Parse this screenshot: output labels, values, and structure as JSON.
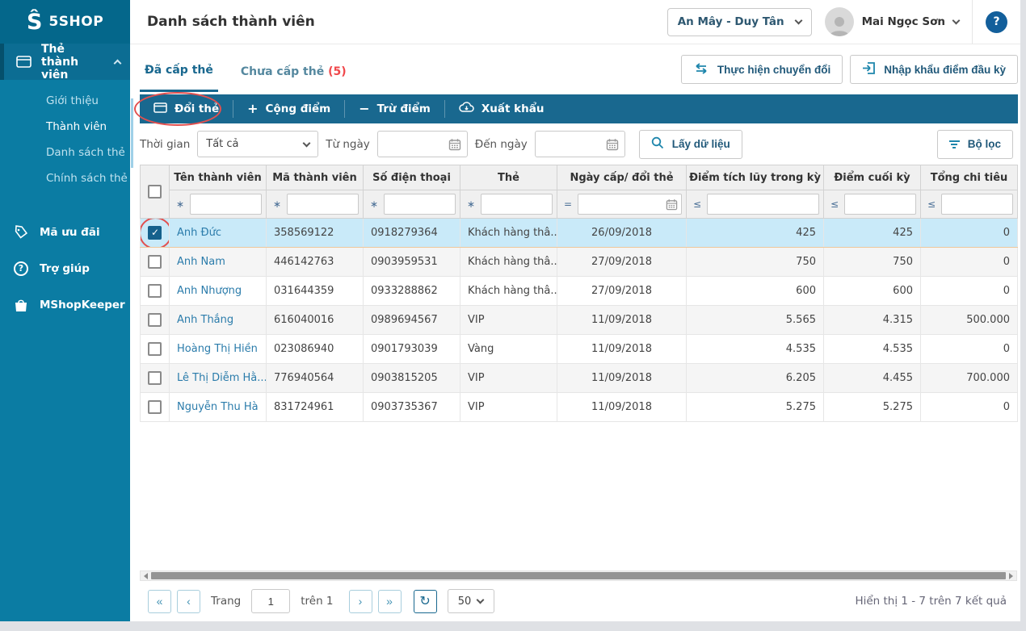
{
  "app": {
    "logo_text": "5SHOP",
    "logo_glyph": "Ŝ"
  },
  "sidebar": {
    "section": {
      "label": "Thẻ thành viên"
    },
    "submenu": [
      {
        "label": "Giới thiệu"
      },
      {
        "label": "Thành viên",
        "active": true
      },
      {
        "label": "Danh sách thẻ"
      },
      {
        "label": "Chính sách thẻ"
      }
    ],
    "items": [
      {
        "label": "Mã ưu đãi",
        "icon": "tag-icon"
      },
      {
        "label": "Trợ giúp",
        "icon": "help-circle-icon",
        "icon_glyph": "?"
      },
      {
        "label": "MShopKeeper",
        "icon": "shopping-bag-icon"
      }
    ]
  },
  "header": {
    "title": "Danh sách thành viên",
    "store_selector": "An Mây - Duy Tân",
    "user_name": "Mai Ngọc Sơn",
    "help_glyph": "?"
  },
  "tabs": [
    {
      "label": "Đã cấp thẻ",
      "active": true
    },
    {
      "label": "Chưa cấp thẻ",
      "badge": "(5)"
    }
  ],
  "actions": {
    "convert": "Thực hiện chuyển đổi",
    "import": "Nhập khẩu điểm đầu kỳ"
  },
  "toolbar": {
    "items": [
      {
        "label": "Đổi thẻ",
        "icon": "card-icon",
        "annotated": true
      },
      {
        "label": "Cộng điểm",
        "icon": "plus-icon",
        "icon_glyph": "+"
      },
      {
        "label": "Trừ điểm",
        "icon": "minus-icon",
        "icon_glyph": "−"
      },
      {
        "label": "Xuất khẩu",
        "icon": "cloud-export-icon"
      }
    ]
  },
  "filters": {
    "time_label": "Thời gian",
    "time_value": "Tất cả",
    "from_label": "Từ ngày",
    "from_value": "",
    "to_label": "Đến ngày",
    "to_value": "",
    "fetch_button": "Lấy dữ liệu",
    "filter_button": "Bộ lọc"
  },
  "table": {
    "columns": [
      {
        "label": "Tên thành viên",
        "operator": "∗"
      },
      {
        "label": "Mã thành viên",
        "operator": "∗"
      },
      {
        "label": "Số điện thoại",
        "operator": "∗"
      },
      {
        "label": "Thẻ",
        "operator": "∗"
      },
      {
        "label": "Ngày cấp/ đổi thẻ",
        "operator": "=",
        "has_calendar": true
      },
      {
        "label": "Điểm tích lũy trong kỳ",
        "operator": "≤"
      },
      {
        "label": "Điểm cuối kỳ",
        "operator": "≤"
      },
      {
        "label": "Tổng chi tiêu",
        "operator": "≤"
      }
    ],
    "rows": [
      {
        "name": "Anh Đức",
        "code": "358569122",
        "phone": "0918279364",
        "card": "Khách hàng thâ...",
        "date": "26/09/2018",
        "points_in_period": "425",
        "points_end": "425",
        "total_spent": "0",
        "selected": true
      },
      {
        "name": "Anh Nam",
        "code": "446142763",
        "phone": "0903959531",
        "card": "Khách hàng thâ...",
        "date": "27/09/2018",
        "points_in_period": "750",
        "points_end": "750",
        "total_spent": "0"
      },
      {
        "name": "Anh Nhượng",
        "code": "031644359",
        "phone": "0933288862",
        "card": "Khách hàng thâ...",
        "date": "27/09/2018",
        "points_in_period": "600",
        "points_end": "600",
        "total_spent": "0"
      },
      {
        "name": "Anh Thắng",
        "code": "616040016",
        "phone": "0989694567",
        "card": "VIP",
        "date": "11/09/2018",
        "points_in_period": "5.565",
        "points_end": "4.315",
        "total_spent": "500.000"
      },
      {
        "name": "Hoàng Thị Hiền",
        "code": "023086940",
        "phone": "0901793039",
        "card": "Vàng",
        "date": "11/09/2018",
        "points_in_period": "4.535",
        "points_end": "4.535",
        "total_spent": "0"
      },
      {
        "name": "Lê Thị Diễm Hằ...",
        "code": "776940564",
        "phone": "0903815205",
        "card": "VIP",
        "date": "11/09/2018",
        "points_in_period": "6.205",
        "points_end": "4.455",
        "total_spent": "700.000"
      },
      {
        "name": "Nguyễn Thu Hà",
        "code": "831724961",
        "phone": "0903735367",
        "card": "VIP",
        "date": "11/09/2018",
        "points_in_period": "5.275",
        "points_end": "5.275",
        "total_spent": "0"
      }
    ]
  },
  "pagination": {
    "page_label": "Trang",
    "page_value": "1",
    "of_label": "trên 1",
    "page_size": "50",
    "summary": "Hiển thị 1 - 7 trên 7 kết quả",
    "icons": {
      "first": "«",
      "prev": "‹",
      "next": "›",
      "last": "»",
      "refresh": "↻"
    }
  },
  "colors": {
    "sidebar": "#0b7ca3",
    "accent": "#19688f",
    "badge_red": "#f0484b",
    "annotation_red": "#e2504f",
    "link": "#2b7cab",
    "selected_row": "#c9eaf9",
    "help_circle": "#135f9b"
  }
}
